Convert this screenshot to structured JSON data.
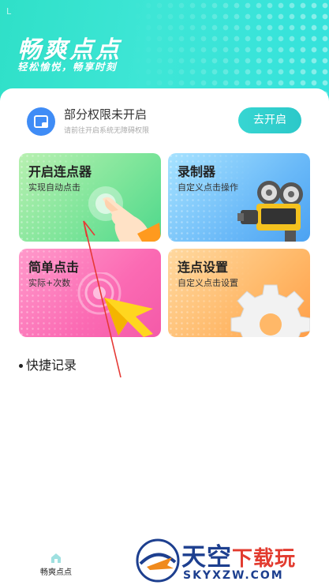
{
  "header": {
    "status_char": "L",
    "title": "畅爽点点",
    "subtitle": "轻松愉悦，畅享时刻"
  },
  "permission": {
    "title": "部分权限未开启",
    "subtitle": "请前往开启系统无障碍权限",
    "button": "去开启"
  },
  "features": [
    {
      "title": "开启连点器",
      "subtitle": "实现自动点击"
    },
    {
      "title": "录制器",
      "subtitle": "自定义点击操作"
    },
    {
      "title": "简单点击",
      "subtitle": "实际+次数"
    },
    {
      "title": "连点设置",
      "subtitle": "自定义点击设置"
    }
  ],
  "quick_records": "快捷记录",
  "bottom_nav": {
    "label": "畅爽点点",
    "icon": "home-icon"
  },
  "watermark": {
    "logo_text": "天空",
    "logo_text_red": "下载玩",
    "url": "SKYXZW.COM"
  },
  "colors": {
    "header_accent": "#35e2dc",
    "button": "#2cc8c9",
    "permission_icon": "#3f8cf6",
    "annotation": "#e53935"
  }
}
